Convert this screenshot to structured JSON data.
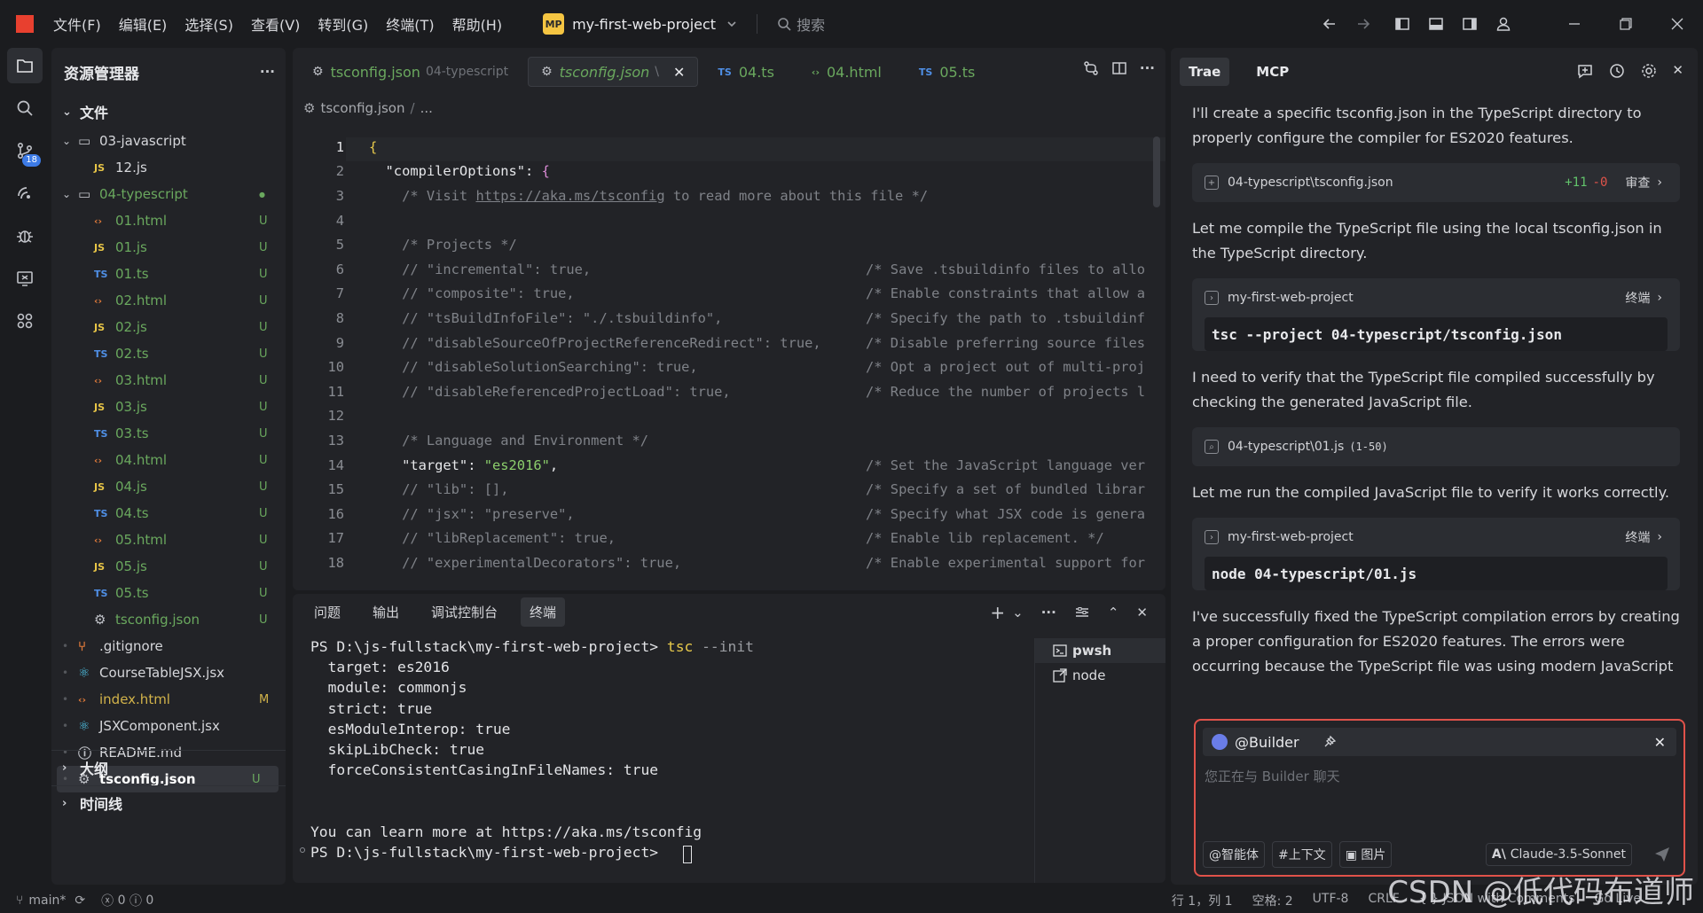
{
  "titlebar": {
    "menus": [
      "文件(F)",
      "编辑(E)",
      "选择(S)",
      "查看(V)",
      "转到(G)",
      "终端(T)",
      "帮助(H)"
    ],
    "project_badge": "MP",
    "project_name": "my-first-web-project",
    "search_placeholder": "搜索"
  },
  "activity": {
    "scm_badge": "18"
  },
  "explorer": {
    "title": "资源管理器",
    "more": "···",
    "files_section": "文件",
    "tree": [
      {
        "name": "03-javascript",
        "icon": "folder",
        "color": "#d6d7db",
        "status": "",
        "indent": 1,
        "chev": "⌄"
      },
      {
        "name": "12.js",
        "icon": "JS",
        "color": "#d6d7db",
        "status": "",
        "indent": 2,
        "chev": ""
      },
      {
        "name": "04-typescript",
        "icon": "folder",
        "color": "#6aa85e",
        "status": "●",
        "indent": 1,
        "chev": "⌄"
      },
      {
        "name": "01.html",
        "icon": "<>",
        "color": "#6aa85e",
        "status": "U",
        "indent": 2,
        "chev": ""
      },
      {
        "name": "01.js",
        "icon": "JS",
        "color": "#6aa85e",
        "status": "U",
        "indent": 2,
        "chev": ""
      },
      {
        "name": "01.ts",
        "icon": "TS",
        "color": "#6aa85e",
        "status": "U",
        "indent": 2,
        "chev": ""
      },
      {
        "name": "02.html",
        "icon": "<>",
        "color": "#6aa85e",
        "status": "U",
        "indent": 2,
        "chev": ""
      },
      {
        "name": "02.js",
        "icon": "JS",
        "color": "#6aa85e",
        "status": "U",
        "indent": 2,
        "chev": ""
      },
      {
        "name": "02.ts",
        "icon": "TS",
        "color": "#6aa85e",
        "status": "U",
        "indent": 2,
        "chev": ""
      },
      {
        "name": "03.html",
        "icon": "<>",
        "color": "#6aa85e",
        "status": "U",
        "indent": 2,
        "chev": ""
      },
      {
        "name": "03.js",
        "icon": "JS",
        "color": "#6aa85e",
        "status": "U",
        "indent": 2,
        "chev": ""
      },
      {
        "name": "03.ts",
        "icon": "TS",
        "color": "#6aa85e",
        "status": "U",
        "indent": 2,
        "chev": ""
      },
      {
        "name": "04.html",
        "icon": "<>",
        "color": "#6aa85e",
        "status": "U",
        "indent": 2,
        "chev": ""
      },
      {
        "name": "04.js",
        "icon": "JS",
        "color": "#6aa85e",
        "status": "U",
        "indent": 2,
        "chev": ""
      },
      {
        "name": "04.ts",
        "icon": "TS",
        "color": "#6aa85e",
        "status": "U",
        "indent": 2,
        "chev": ""
      },
      {
        "name": "05.html",
        "icon": "<>",
        "color": "#6aa85e",
        "status": "U",
        "indent": 2,
        "chev": ""
      },
      {
        "name": "05.js",
        "icon": "JS",
        "color": "#6aa85e",
        "status": "U",
        "indent": 2,
        "chev": ""
      },
      {
        "name": "05.ts",
        "icon": "TS",
        "color": "#6aa85e",
        "status": "U",
        "indent": 2,
        "chev": ""
      },
      {
        "name": "tsconfig.json",
        "icon": "gear",
        "color": "#6aa85e",
        "status": "U",
        "indent": 2,
        "chev": ""
      },
      {
        "name": ".gitignore",
        "icon": "git",
        "color": "#d6d7db",
        "status": "",
        "indent": 1,
        "chev": ""
      },
      {
        "name": "CourseTableJSX.jsx",
        "icon": "react",
        "color": "#d6d7db",
        "status": "",
        "indent": 1,
        "chev": ""
      },
      {
        "name": "index.html",
        "icon": "<>",
        "color": "#d2b34a",
        "status": "M",
        "indent": 1,
        "chev": ""
      },
      {
        "name": "JSXComponent.jsx",
        "icon": "react",
        "color": "#d6d7db",
        "status": "",
        "indent": 1,
        "chev": ""
      },
      {
        "name": "README.md",
        "icon": "info",
        "color": "#d6d7db",
        "status": "",
        "indent": 1,
        "chev": ""
      },
      {
        "name": "tsconfig.json",
        "icon": "gear",
        "color": "#ffffff",
        "status": "U",
        "indent": 1,
        "chev": "",
        "selected": true
      }
    ],
    "outline_section": "大纲",
    "timeline_section": "时间线"
  },
  "editor": {
    "tabs": [
      {
        "label": "tsconfig.json",
        "desc": "04-typescript",
        "icon": "gear",
        "color": "#6aa85e",
        "active": false
      },
      {
        "label": "tsconfig.json",
        "desc": "\\",
        "icon": "gear",
        "color": "#6aa85e",
        "active": true
      },
      {
        "label": "04.ts",
        "desc": "",
        "icon": "TS",
        "color": "#6aa85e",
        "active": false
      },
      {
        "label": "04.html",
        "desc": "",
        "icon": "<>",
        "color": "#6aa85e",
        "active": false
      },
      {
        "label": "05.ts",
        "desc": "",
        "icon": "TS",
        "color": "#6aa85e",
        "active": false
      }
    ],
    "breadcrumb": [
      "tsconfig.json",
      "..."
    ],
    "lines": [
      {
        "n": "1",
        "a": "{",
        "b": "",
        "k": "brace"
      },
      {
        "n": "2",
        "a": "  \"compilerOptions\": {",
        "b": "",
        "k": "key"
      },
      {
        "n": "3",
        "a": "    /* Visit https://aka.ms/tsconfig to read more about this file */",
        "b": "",
        "k": "cm"
      },
      {
        "n": "4",
        "a": "",
        "b": "",
        "k": "cm"
      },
      {
        "n": "5",
        "a": "    /* Projects */",
        "b": "",
        "k": "cm"
      },
      {
        "n": "6",
        "a": "    // \"incremental\": true,",
        "b": "/* Save .tsbuildinfo files to allo",
        "k": "cm"
      },
      {
        "n": "7",
        "a": "    // \"composite\": true,",
        "b": "/* Enable constraints that allow a",
        "k": "cm"
      },
      {
        "n": "8",
        "a": "    // \"tsBuildInfoFile\": \"./.tsbuildinfo\",",
        "b": "/* Specify the path to .tsbuildinf",
        "k": "cm"
      },
      {
        "n": "9",
        "a": "    // \"disableSourceOfProjectReferenceRedirect\": true,",
        "b": "/* Disable preferring source files",
        "k": "cm"
      },
      {
        "n": "10",
        "a": "    // \"disableSolutionSearching\": true,",
        "b": "/* Opt a project out of multi-proj",
        "k": "cm"
      },
      {
        "n": "11",
        "a": "    // \"disableReferencedProjectLoad\": true,",
        "b": "/* Reduce the number of projects l",
        "k": "cm"
      },
      {
        "n": "12",
        "a": "",
        "b": "",
        "k": "cm"
      },
      {
        "n": "13",
        "a": "    /* Language and Environment */",
        "b": "",
        "k": "cm"
      },
      {
        "n": "14",
        "a": "    \"target\": \"es2016\",",
        "b": "/* Set the JavaScript language ver",
        "k": "target"
      },
      {
        "n": "15",
        "a": "    // \"lib\": [],",
        "b": "/* Specify a set of bundled librar",
        "k": "cm"
      },
      {
        "n": "16",
        "a": "    // \"jsx\": \"preserve\",",
        "b": "/* Specify what JSX code is genera",
        "k": "cm"
      },
      {
        "n": "17",
        "a": "    // \"libReplacement\": true,",
        "b": "/* Enable lib replacement. */",
        "k": "cm"
      },
      {
        "n": "18",
        "a": "    // \"experimentalDecorators\": true,",
        "b": "/* Enable experimental support for",
        "k": "cm"
      }
    ]
  },
  "panel": {
    "tabs": [
      "问题",
      "输出",
      "调试控制台",
      "终端"
    ],
    "terminal_lines": [
      "PS D:\\js-fullstack\\my-first-web-project> tsc --init",
      "  target: es2016",
      "  module: commonjs",
      "  strict: true",
      "  esModuleInterop: true",
      "  skipLibCheck: true",
      "  forceConsistentCasingInFileNames: true",
      "",
      "",
      "You can learn more at https://aka.ms/tsconfig",
      "PS D:\\js-fullstack\\my-first-web-project> "
    ],
    "terminals": [
      "pwsh",
      "node"
    ]
  },
  "chat": {
    "tabs": [
      "Trae",
      "MCP"
    ],
    "items": [
      {
        "type": "msg",
        "text": "I'll create a specific tsconfig.json in the TypeScript directory to properly configure the compiler for ES2020 features."
      },
      {
        "type": "file",
        "label": "04-typescript\\tsconfig.json",
        "plus": "+11",
        "minus": "-0",
        "action": "审查"
      },
      {
        "type": "msg",
        "text": "Let me compile the TypeScript file using the local tsconfig.json in the TypeScript directory."
      },
      {
        "type": "term",
        "label": "my-first-web-project",
        "action": "终端",
        "cmd": "tsc --project 04-typescript/tsconfig.json"
      },
      {
        "type": "msg",
        "text": "I need to verify that the TypeScript file compiled successfully by checking the generated JavaScript file."
      },
      {
        "type": "read",
        "label": "04-typescript\\01.js",
        "range": "(1-50)"
      },
      {
        "type": "msg",
        "text": "Let me run the compiled JavaScript file to verify it works correctly."
      },
      {
        "type": "term",
        "label": "my-first-web-project",
        "action": "终端",
        "cmd": "node 04-typescript/01.js"
      },
      {
        "type": "msg",
        "text": "I've successfully fixed the TypeScript compilation errors by creating a proper configuration for ES2020 features. The errors were occurring because the TypeScript file was using modern JavaScript features (Symbol and BigInt) that require newer ECMAScript versions than the de"
      }
    ],
    "input": {
      "agent": "@Builder",
      "placeholder": "您正在与 Builder 聊天",
      "chips": [
        "@智能体",
        "#上下文",
        "图片"
      ],
      "model": "Claude-3.5-Sonnet"
    }
  },
  "status": {
    "branch": "main*",
    "errors": "0",
    "warnings": "0",
    "right": [
      "行 1，列 1",
      "空格: 2",
      "UTF-8",
      "CRLF",
      "{ } JSON with Comments",
      "Go Live"
    ],
    "watermark": "CSDN @低代码布道师"
  }
}
